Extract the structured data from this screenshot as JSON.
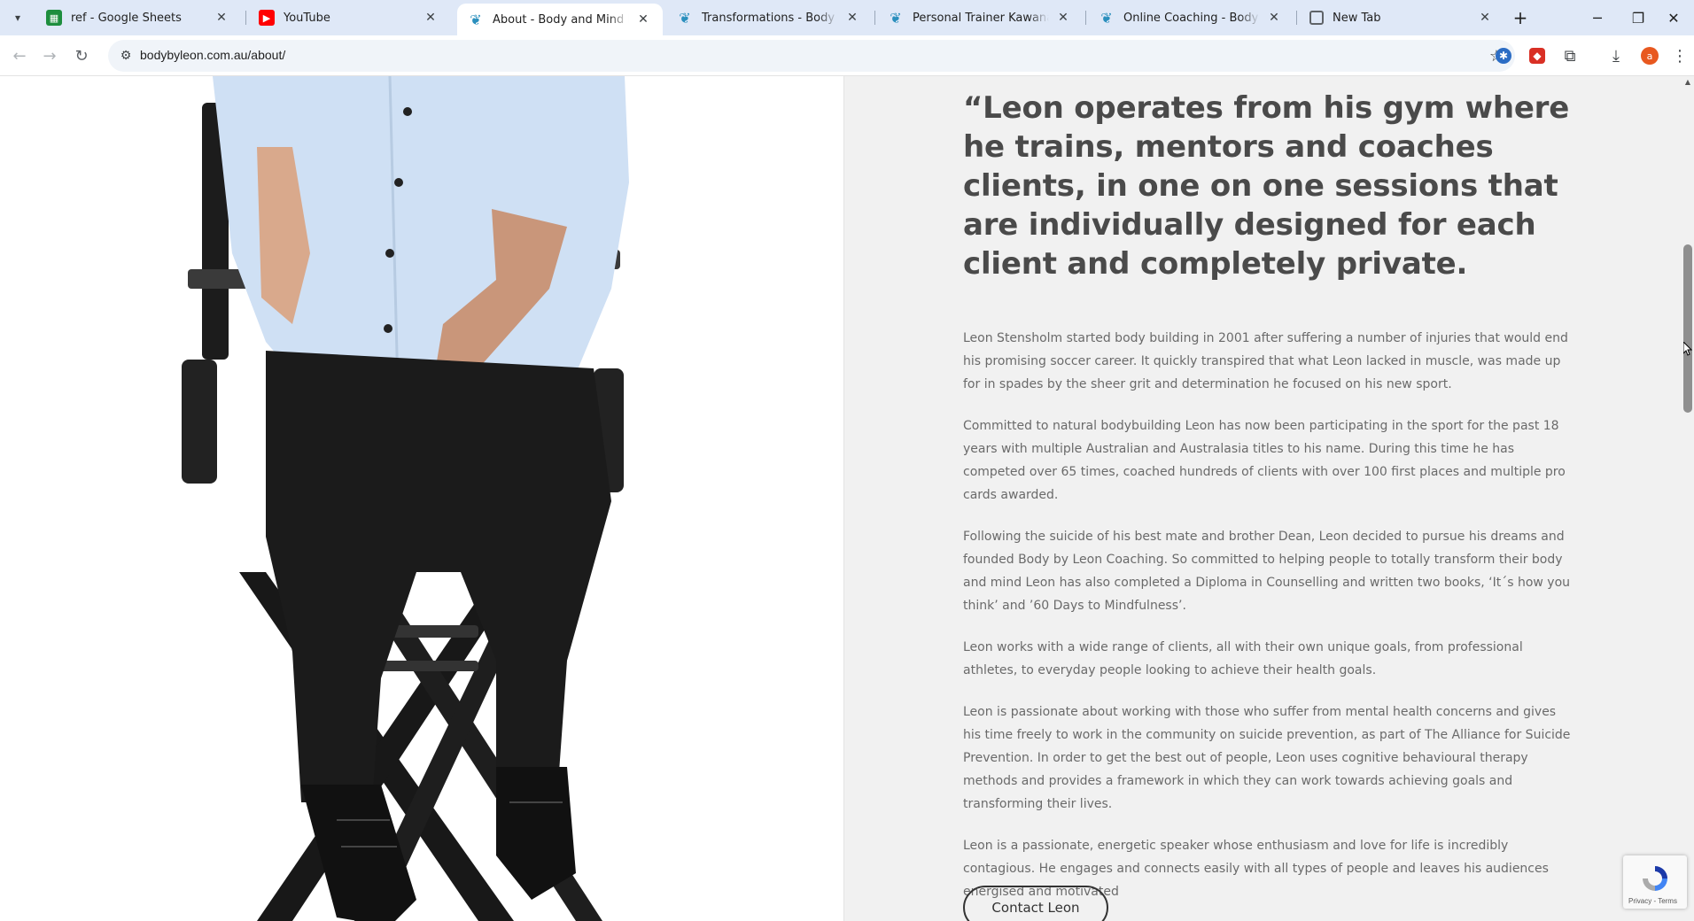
{
  "browser": {
    "tabs": [
      {
        "title": "ref - Google Sheets",
        "favicon": "sheets-icon"
      },
      {
        "title": "YouTube",
        "favicon": "youtube-icon"
      },
      {
        "title": "About - Body and Mind by Leon",
        "favicon": "leaf-logo-icon",
        "active": true
      },
      {
        "title": "Transformations - Body and Mind by Leon",
        "favicon": "leaf-logo-icon"
      },
      {
        "title": "Personal Trainer Kawana Sunshine Coast",
        "favicon": "leaf-logo-icon"
      },
      {
        "title": "Online Coaching - Body and Mind by Leon",
        "favicon": "leaf-logo-icon"
      },
      {
        "title": "New Tab",
        "favicon": "chrome-icon"
      }
    ],
    "url": "bodybyleon.com.au/about/",
    "avatar_initial": "a"
  },
  "page": {
    "quote": "“Leon operates from his gym where he trains, mentors and coaches clients, in one on one sessions that are individually designed for each client and completely private.",
    "bio": [
      "Leon Stensholm started body building in 2001 after suffering a number of injuries that would end his promising soccer career. It quickly transpired that what Leon lacked in muscle, was made up for in spades by the sheer grit and determination he focused on his new sport.",
      "Committed to natural bodybuilding Leon has now been participating in the sport for the past 18 years with multiple Australian and Australasia titles to his name. During this time he has competed over 65 times, coached hundreds of clients with over 100 first places and multiple pro cards awarded.",
      "Following the suicide of his best mate and brother Dean, Leon decided to pursue his dreams and founded Body by Leon Coaching. So committed to helping people to totally transform their body and mind Leon has also completed a Diploma in Counselling and written two books, ‘It´s how you think’ and ’60 Days to Mindfulness’.",
      "Leon works with a wide range of clients, all with their own unique goals, from professional athletes, to everyday people looking to achieve their health goals.",
      "Leon is passionate about working with those who suffer from mental health concerns and gives his time freely to work in the community on suicide prevention, as part of The Alliance for Suicide Prevention. In order to get the best out of people, Leon uses cognitive behavioural therapy methods and provides a framework in which they can work towards achieving goals and transforming their lives.",
      "Leon is a passionate, energetic speaker whose enthusiasm and love for life is incredibly contagious. He engages and connects easily with all types of people and leaves his audiences energised and motivated"
    ],
    "contact_button": "Contact Leon",
    "recaptcha_text": "Privacy - Terms"
  },
  "colors": {
    "tabstrip": "#dfe8f7",
    "right_panel": "#f1f1f1",
    "heading": "#4a4a4a",
    "body_text": "#6a6a6a",
    "shirt": "#cfe0f4",
    "pants": "#1b1b1b"
  }
}
